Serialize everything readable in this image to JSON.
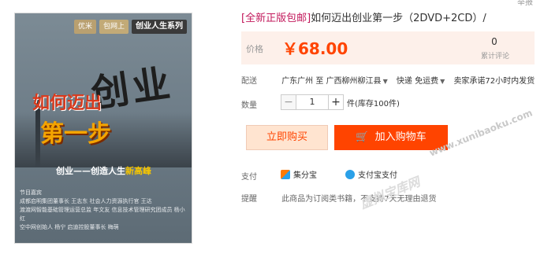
{
  "cover": {
    "badge1": "优米",
    "badge2": "包网上",
    "badge3": "创业人生系列",
    "big": "创业",
    "red1": "如何迈出",
    "red2": "第一步",
    "sub_prefix": "创业——创造人生",
    "sub_highlight": "新高峰",
    "credits": "节目嘉宾\n成都启明集团董事长 王志东 社会人力资源执行官 王达\n渡渡网智能基础管理运营总监 年文友 信息技术管理研究团成员 杨小红\n空中网创始人 杨宁 启迪控股董事长 梅萌"
  },
  "top_link": "举报",
  "product": {
    "title_tag": "[全新正版包邮]",
    "title_rest": "如何迈出创业第一步（2DVD+2CD）/"
  },
  "price": {
    "label": "价格",
    "value": "￥68.00",
    "review_count": "0",
    "review_label": "累计评论"
  },
  "shipping": {
    "label": "配送",
    "from": "广东广州 至",
    "to": "广西柳州柳江县",
    "method": "快递 免运费",
    "promise": "卖家承诺72小时内发货"
  },
  "quantity": {
    "label": "数量",
    "value": "1",
    "stock": "件(库存100件)"
  },
  "buttons": {
    "buy_now": "立即购买",
    "add_cart": "加入购物车"
  },
  "payment": {
    "label": "支付",
    "method1": "集分宝",
    "method2": "支付宝支付"
  },
  "notice": {
    "label": "提醒",
    "text": "此商品为订阅类书籍，不支持7天无理由退货"
  },
  "watermarks": {
    "url": "www.xunibaoku.com",
    "site": "虚拟宝库网"
  },
  "colors": {
    "accent": "#ff4400",
    "price_bg": "#fdf0ea",
    "title_tag": "#c2185b"
  }
}
